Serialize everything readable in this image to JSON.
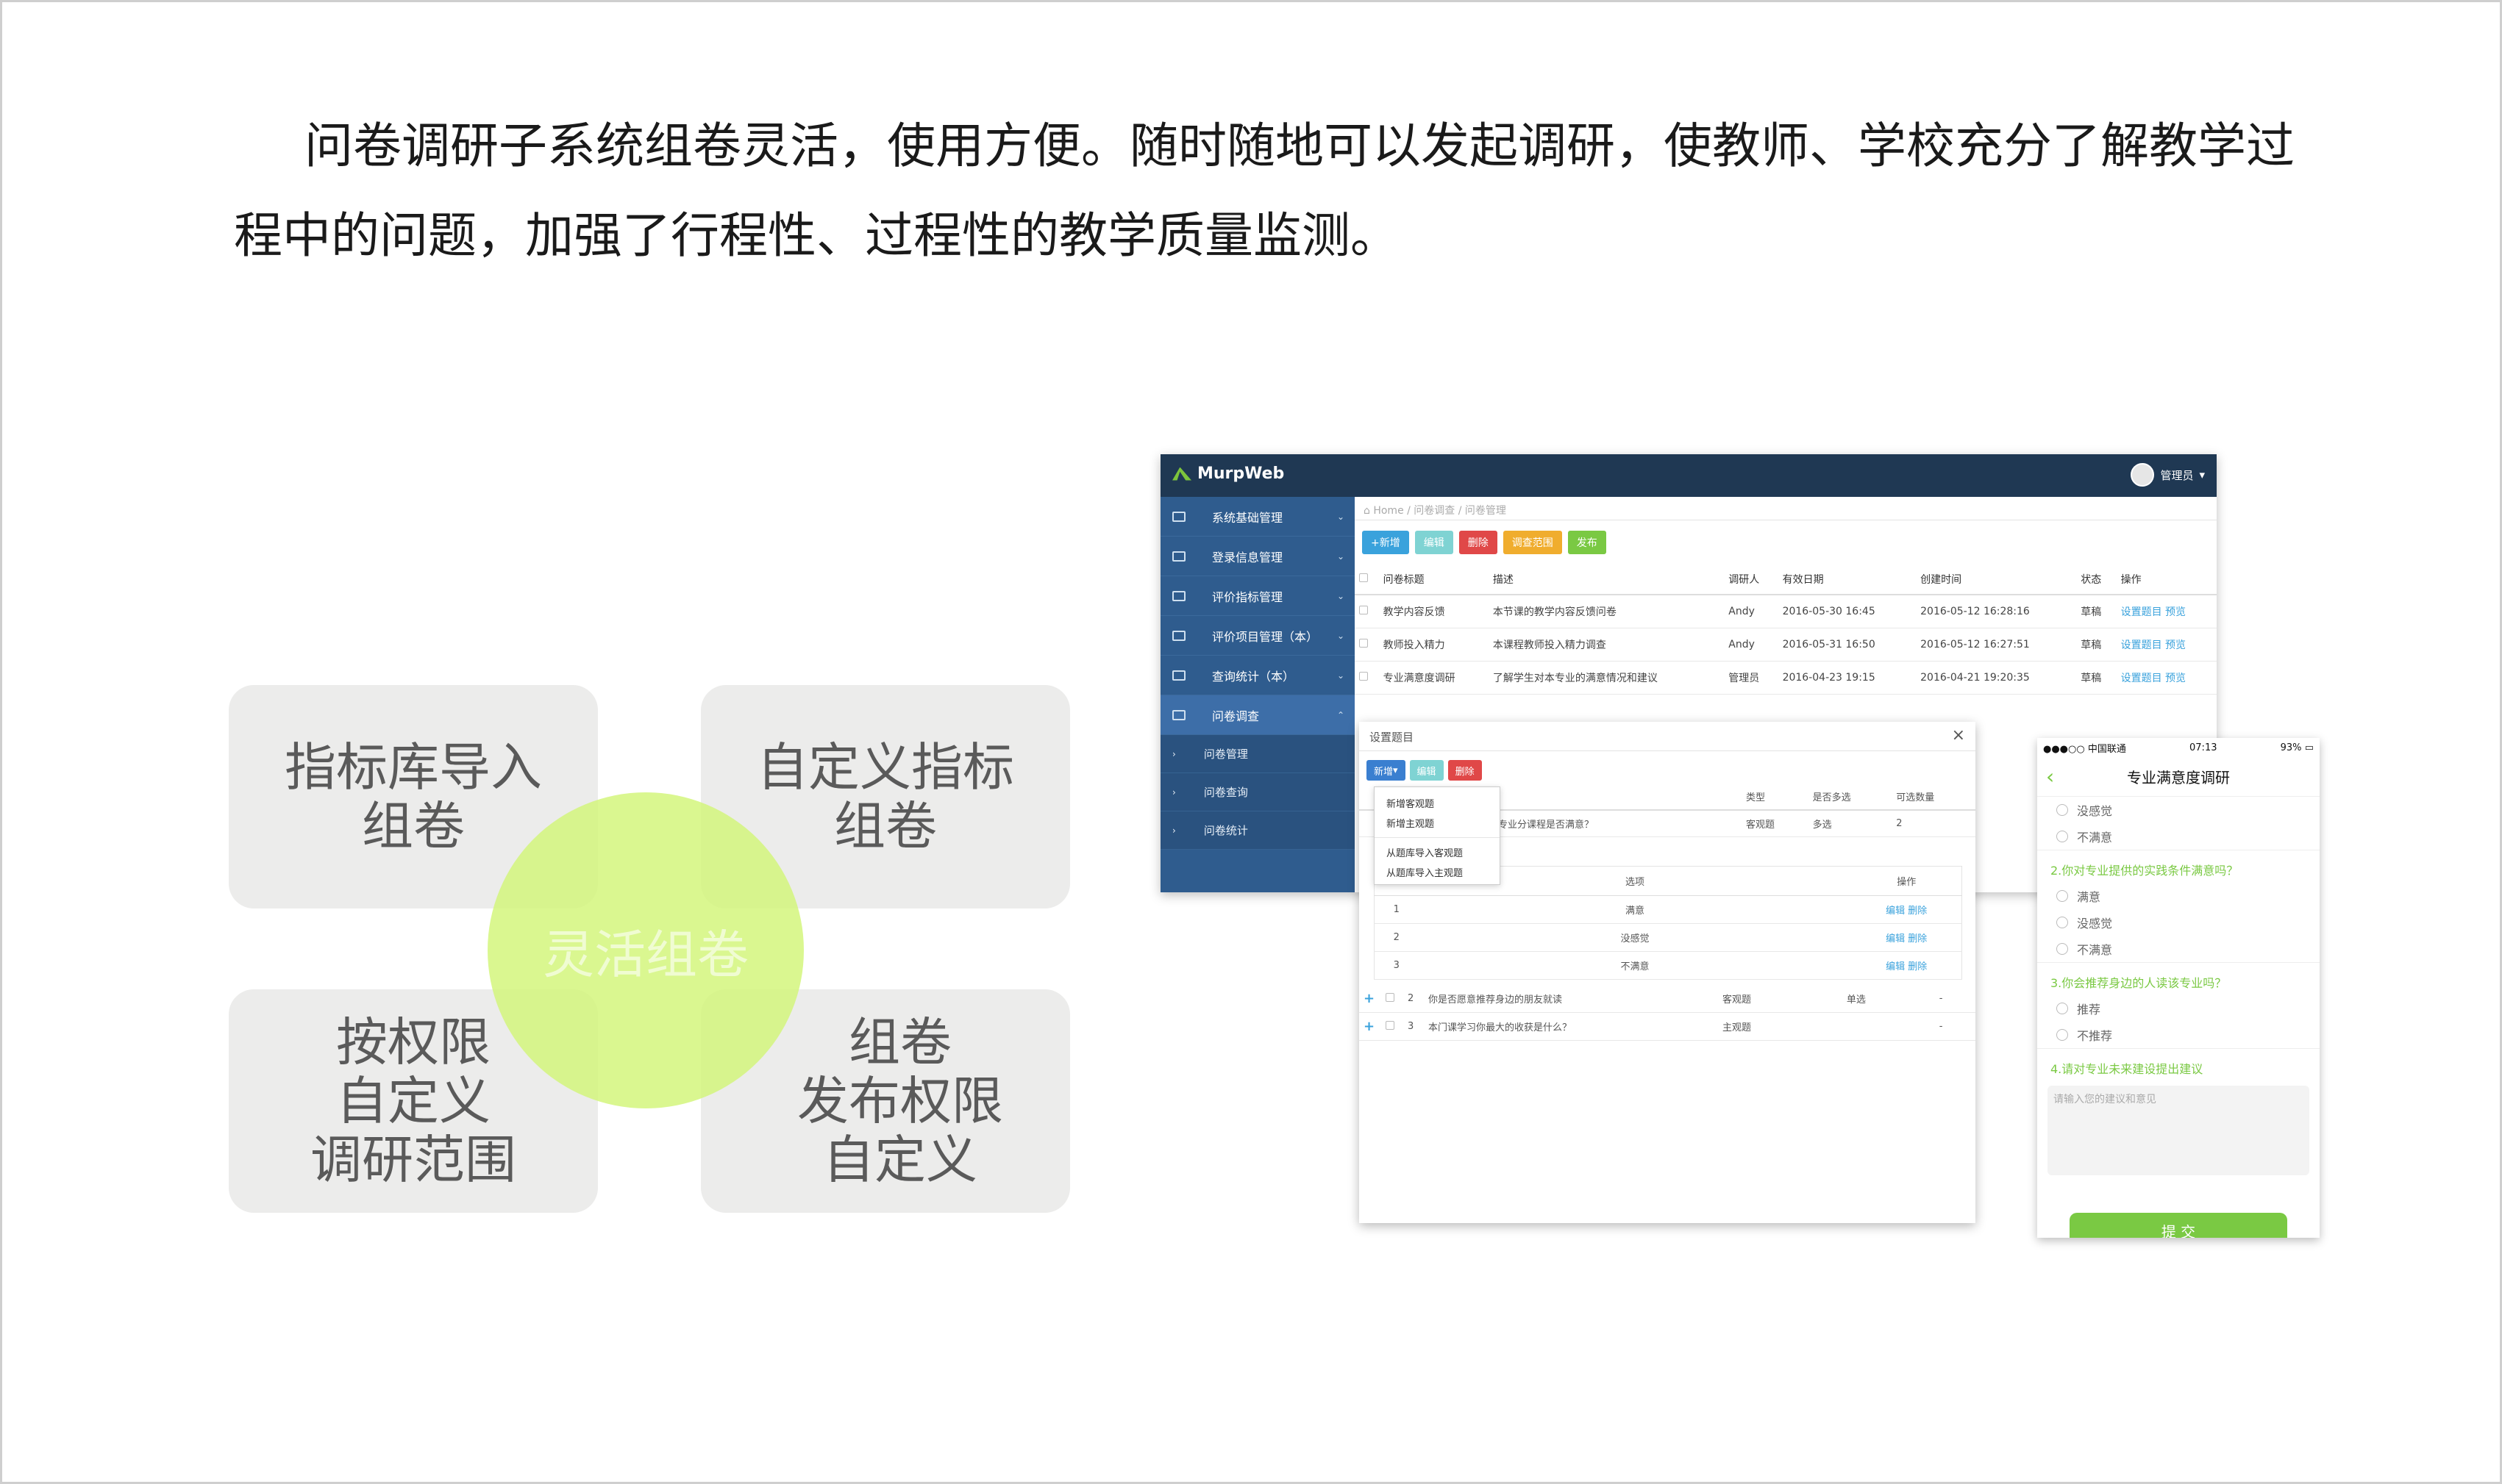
{
  "intro": {
    "line1": "问卷调研子系统组卷灵活，使用方便。随时随地可以发起调研，使教师、学校充分了解教学过",
    "line2": "程中的问题，加强了行程性、过程性的教学质量监测。"
  },
  "features": {
    "top_left": "指标库导入\n组卷",
    "top_right": "自定义指标\n组卷",
    "bottom_left": "按权限\n自定义\n调研范围",
    "bottom_right": "组卷\n发布权限\n自定义",
    "center": "灵活组卷"
  },
  "app": {
    "brand": "MurpWeb",
    "user": "管理员",
    "sidebar": [
      {
        "label": "系统基础管理",
        "icon": "dashboard-icon"
      },
      {
        "label": "登录信息管理",
        "icon": "edit-icon"
      },
      {
        "label": "评价指标管理",
        "icon": "columns-icon"
      },
      {
        "label": "评价项目管理（本）",
        "icon": "book-icon"
      },
      {
        "label": "查询统计（本）",
        "icon": "list-icon"
      },
      {
        "label": "问卷调查",
        "icon": "survey-icon"
      }
    ],
    "submenu": [
      "问卷管理",
      "问卷查询",
      "问卷统计"
    ],
    "breadcrumb": "Home / 问卷调查 / 问卷管理",
    "buttons": {
      "add": "+新增",
      "edit": "编辑",
      "delete": "删除",
      "scope": "调查范围",
      "publish": "发布"
    },
    "button_colors": {
      "add": "#3aa2dc",
      "edit": "#7fd3d3",
      "delete": "#e04848",
      "scope": "#f0ad2e",
      "publish": "#7ac943"
    },
    "table_headers": [
      "问卷标题",
      "描述",
      "调研人",
      "有效日期",
      "创建时间",
      "状态",
      "操作"
    ],
    "rows": [
      [
        "教学内容反馈",
        "本节课的教学内容反馈问卷",
        "Andy",
        "2016-05-30 16:45",
        "2016-05-12 16:28:16",
        "草稿",
        "设置题目 预览"
      ],
      [
        "教师投入精力",
        "本课程教师投入精力调查",
        "Andy",
        "2016-05-31 16:50",
        "2016-05-12 16:27:51",
        "草稿",
        "设置题目 预览"
      ],
      [
        "专业满意度调研",
        "了解学生对本专业的满意情况和建议",
        "管理员",
        "2016-04-23 19:15",
        "2016-04-21 19:20:35",
        "草稿",
        "设置题目 预览"
      ]
    ]
  },
  "modal": {
    "title": "设置题目",
    "buttons": {
      "add": "新增",
      "edit": "编辑",
      "delete": "删除"
    },
    "dropdown": [
      "新增客观题",
      "新增主观题",
      "从题库导入客观题",
      "从题库导入主观题"
    ],
    "headers": [
      "类型",
      "是否多选",
      "可选数量"
    ],
    "row1": {
      "text": "本专业分课程是否满意？",
      "type": "客观题",
      "multi": "多选",
      "count": "2"
    },
    "inner_headers": [
      "选项",
      "操作"
    ],
    "options": [
      {
        "num": "1",
        "label": "满意",
        "action": "编辑 删除"
      },
      {
        "num": "2",
        "label": "没感觉",
        "action": "编辑 删除"
      },
      {
        "num": "3",
        "label": "不满意",
        "action": "编辑 删除"
      }
    ],
    "rows": [
      {
        "num": "2",
        "text": "你是否愿意推荐身边的朋友就读",
        "type": "客观题",
        "multi": "单选",
        "count": "-"
      },
      {
        "num": "3",
        "text": "本门课学习你最大的收获是什么？",
        "type": "主观题",
        "multi": "",
        "count": "-"
      }
    ]
  },
  "phone": {
    "carrier": "●●●○○ 中国联通",
    "time": "07:13",
    "battery": "93%",
    "title": "专业满意度调研",
    "q1_options": [
      "没感觉",
      "不满意"
    ],
    "q2": "2.你对专业提供的实践条件满意吗？",
    "q2_options": [
      "满意",
      "没感觉",
      "不满意"
    ],
    "q3": "3.你会推荐身边的人读该专业吗？",
    "q3_options": [
      "推荐",
      "不推荐"
    ],
    "q4": "4.请对专业未来建设提出建议",
    "q4_placeholder": "请输入您的建议和意见",
    "submit": "提 交"
  }
}
